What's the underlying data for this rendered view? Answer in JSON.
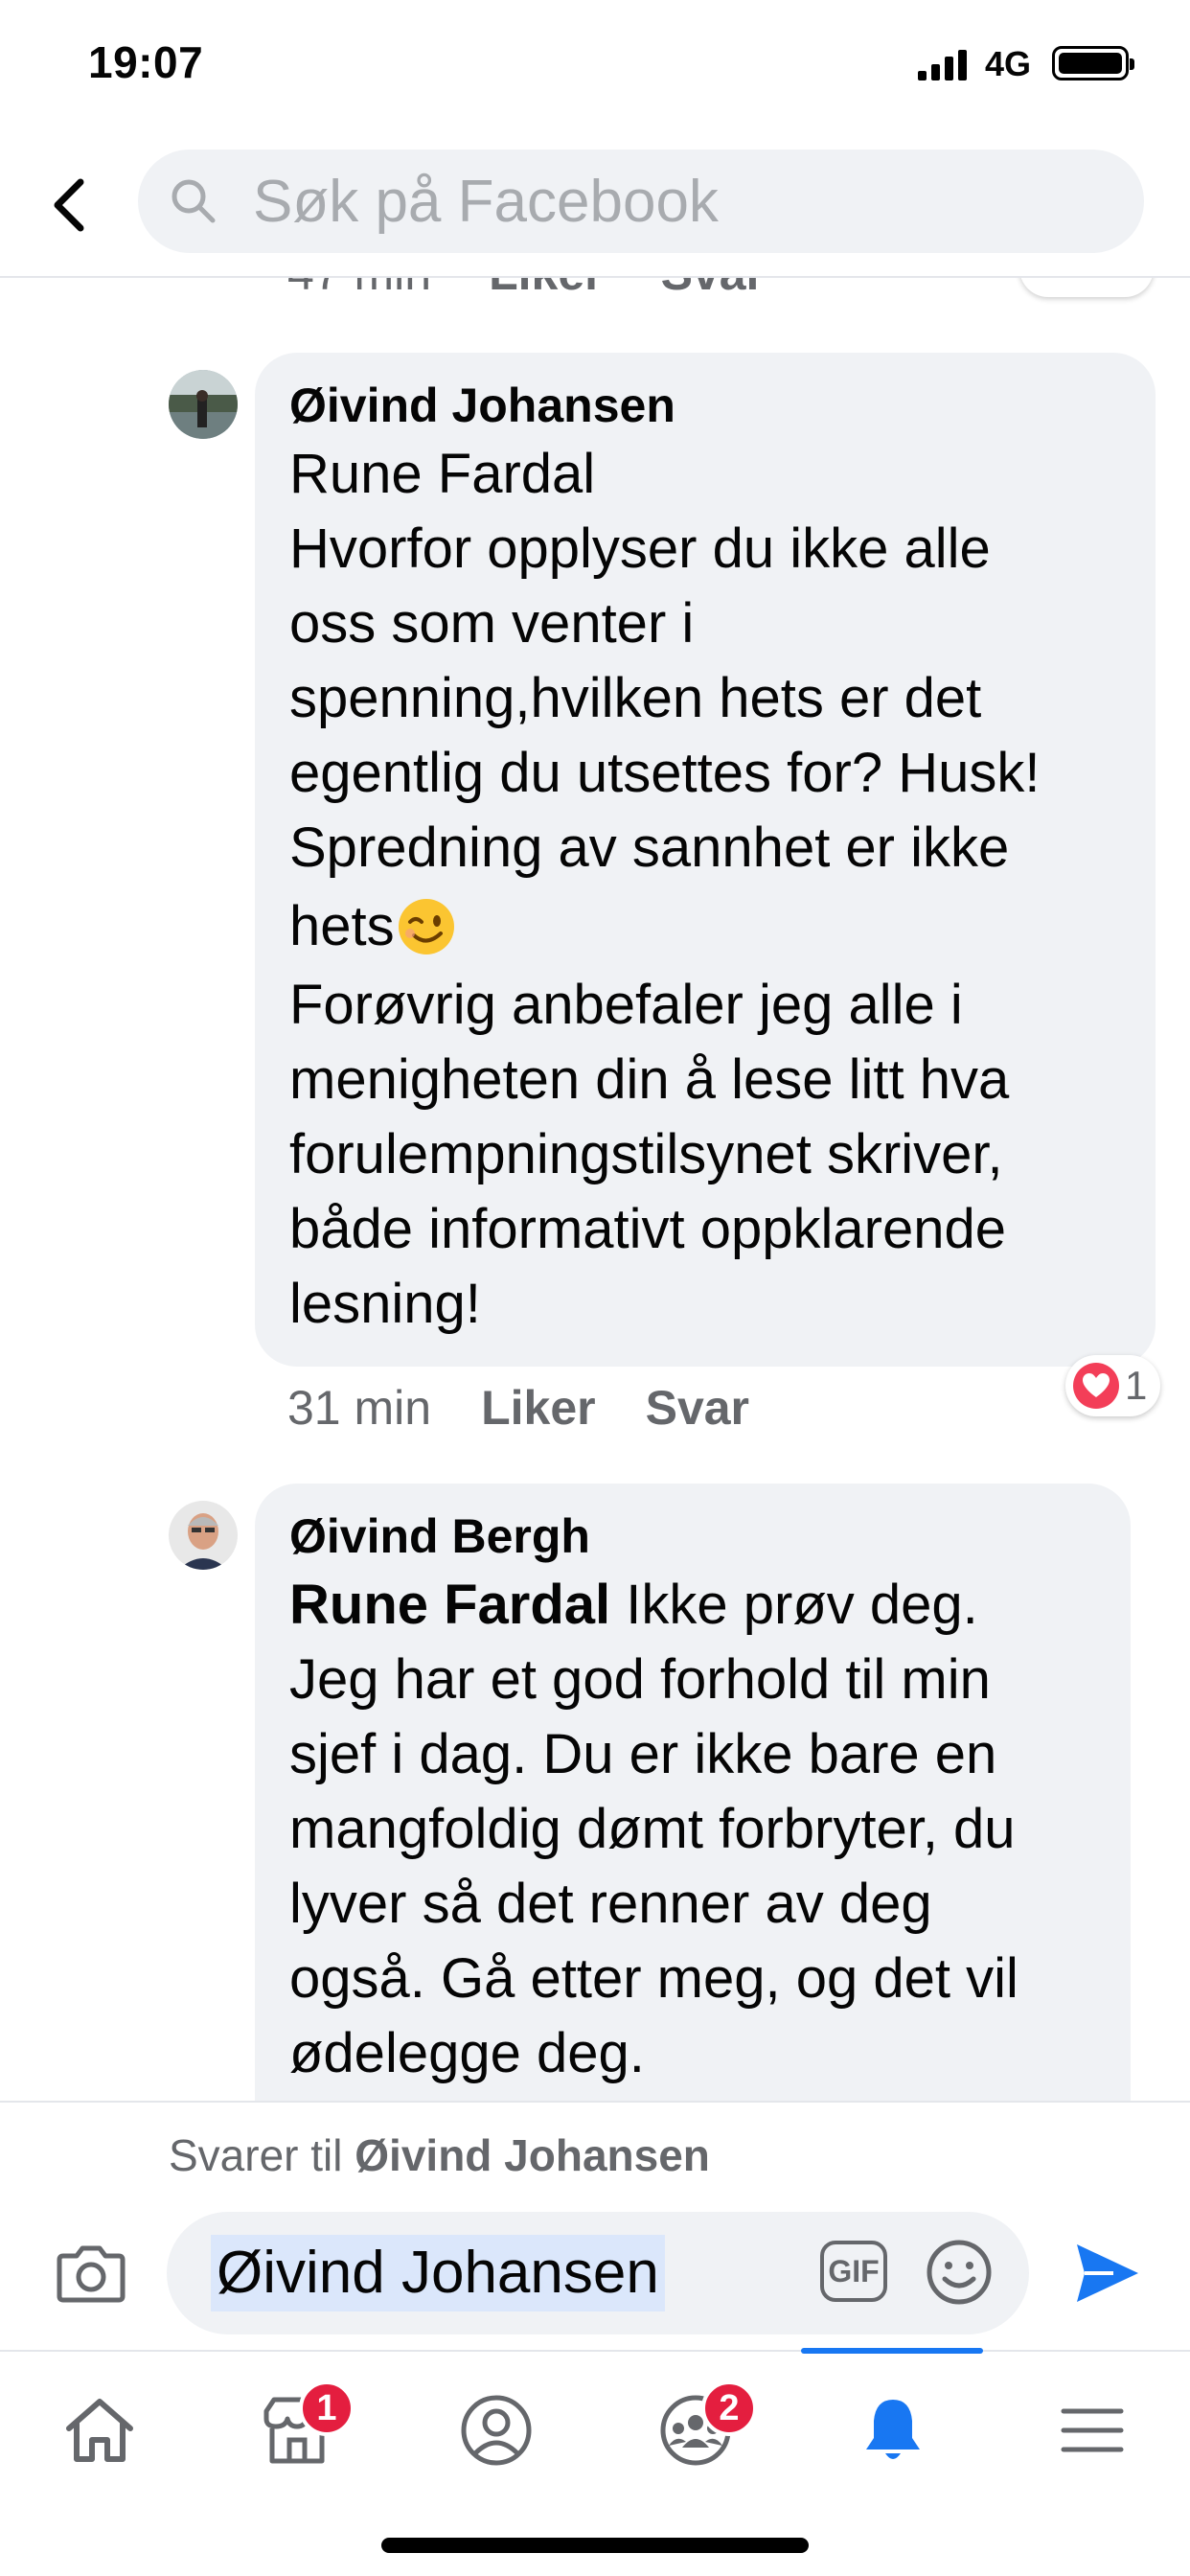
{
  "status_bar": {
    "time": "19:07",
    "network": "4G"
  },
  "header": {
    "search_placeholder": "Søk på Facebook"
  },
  "previous_comment": {
    "time": "47 min",
    "like_label": "Liker",
    "reply_label": "Svar"
  },
  "comments": [
    {
      "author": "Øivind Johansen",
      "lines": [
        "Rune Fardal",
        "Hvorfor opplyser du ikke alle",
        "oss som venter i",
        "spenning,hvilken hets er det",
        "egentlig du utsettes for? Husk!",
        "Spredning av sannhet er ikke",
        "hets",
        "Forøvrig anbefaler jeg alle i",
        "menigheten din å lese litt hva",
        "forulempningstilsynet skriver,",
        "både informativt oppklarende",
        "lesning!"
      ],
      "emoji": "winking-face",
      "time": "31 min",
      "like_label": "Liker",
      "reply_label": "Svar",
      "reaction_count": "1"
    },
    {
      "author": "Øivind Bergh",
      "mention": "Rune Fardal",
      "first_line_rest": " Ikke prøv deg.",
      "lines": [
        "Jeg har et god forhold til min",
        "sjef i dag. Du er ikke bare en",
        "mangfoldig dømt forbryter, du",
        "lyver så det renner av deg",
        "også. Gå etter meg, og det vil",
        "ødelegge deg."
      ]
    }
  ],
  "composer": {
    "replying_prefix": "Svarer til ",
    "replying_name": "Øivind Johansen",
    "input_value": "Øivind Johansen",
    "gif_label": "GIF"
  },
  "tabbar": {
    "marketplace_badge": "1",
    "groups_badge": "2",
    "active_tab": "notifications"
  },
  "colors": {
    "accent": "#1877f2",
    "bubble": "#f0f2f5",
    "badge": "#e41e3f",
    "muted": "#65676b"
  }
}
